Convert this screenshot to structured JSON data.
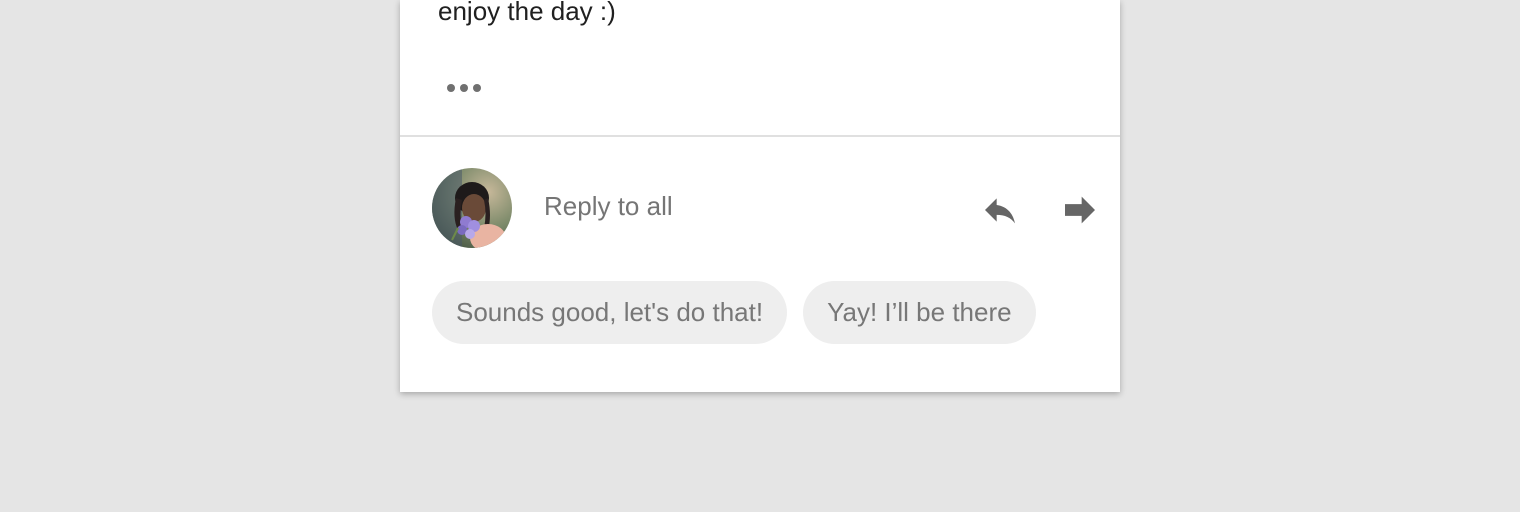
{
  "message": {
    "body_tail": "enjoy the day :)",
    "more_icon": "more-horiz-icon"
  },
  "reply_bar": {
    "avatar_icon": "user-avatar-photo",
    "placeholder": "Reply to all",
    "reply_icon": "reply-icon",
    "forward_icon": "forward-icon"
  },
  "smart_replies": [
    {
      "label": "Sounds good, let's do that!"
    },
    {
      "label": "Yay! I’ll be there"
    }
  ],
  "colors": {
    "background": "#e5e5e5",
    "card": "#ffffff",
    "text_primary": "#202020",
    "text_secondary": "#757575",
    "icon": "#666666",
    "chip_bg": "#eeeeee"
  }
}
